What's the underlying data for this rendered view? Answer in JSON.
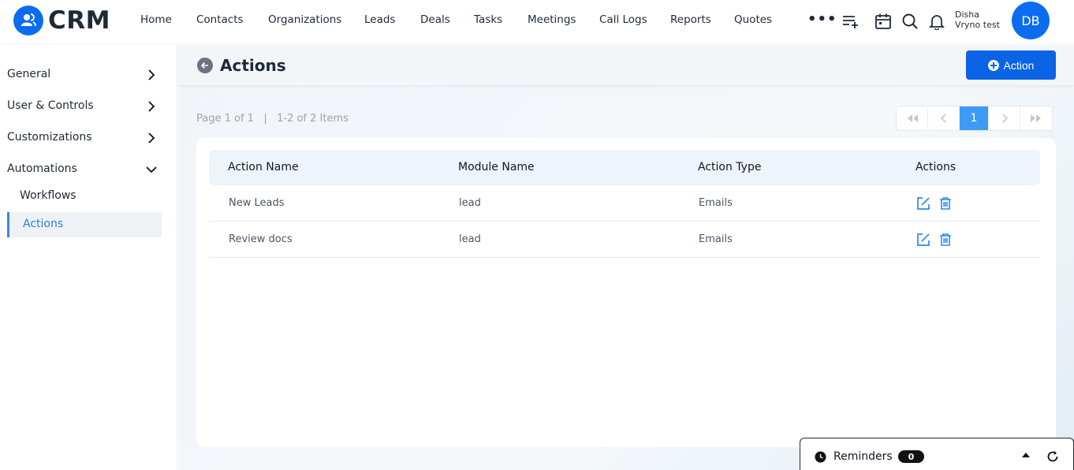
{
  "app": {
    "logo_text": "CRM"
  },
  "nav": {
    "items": [
      "Home",
      "Contacts",
      "Organizations",
      "Leads",
      "Deals",
      "Tasks",
      "Meetings",
      "Call Logs",
      "Reports",
      "Quotes"
    ],
    "more": "•••"
  },
  "user": {
    "first": "Disha",
    "org": "Vryno test",
    "initials": "DB"
  },
  "sidebar": {
    "items": [
      {
        "label": "General"
      },
      {
        "label": "User & Controls"
      },
      {
        "label": "Customizations"
      },
      {
        "label": "Automations"
      }
    ],
    "sub": [
      {
        "label": "Workflows"
      },
      {
        "label": "Actions"
      }
    ]
  },
  "page": {
    "title": "Actions",
    "add_button": "Action",
    "paging_info": "Page 1 of 1   |   1-2 of 2 Items",
    "current_page": "1"
  },
  "pager": {
    "first": "«",
    "prev": "‹",
    "next": "›",
    "last": "»"
  },
  "table": {
    "headers": [
      "Action Name",
      "Module Name",
      "Action Type",
      "Actions"
    ],
    "rows": [
      {
        "name": "New Leads",
        "module": "lead",
        "type": "Emails"
      },
      {
        "name": "Review docs",
        "module": "lead",
        "type": "Emails"
      }
    ]
  },
  "reminders": {
    "label": "Reminders",
    "count": "0"
  },
  "colors": {
    "primary": "#0b63e5",
    "active": "#2b7de9",
    "icon_blue": "#2b8ae8"
  }
}
